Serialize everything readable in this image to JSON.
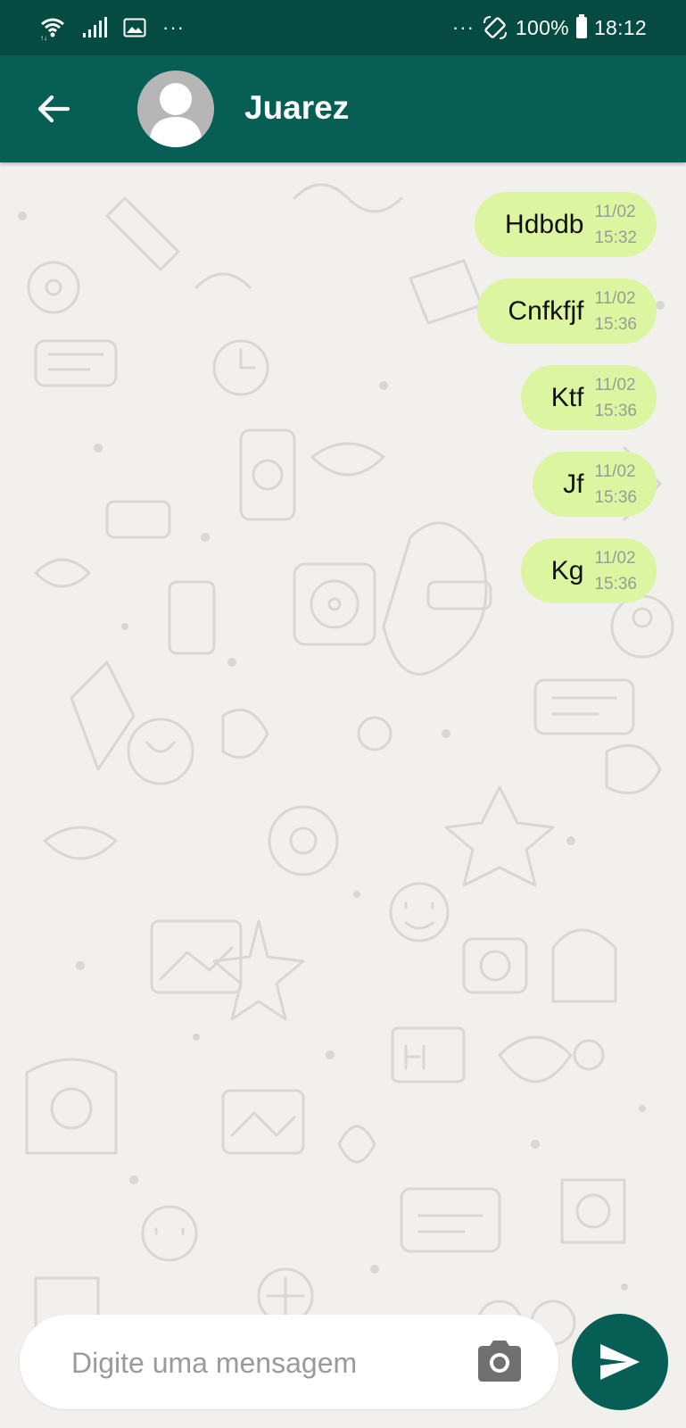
{
  "status_bar": {
    "left_dots": "···",
    "right_dots": "···",
    "battery": "100%",
    "time": "18:12"
  },
  "header": {
    "contact_name": "Juarez",
    "icons": [
      "back-arrow-icon",
      "avatar-person-icon"
    ]
  },
  "messages": [
    {
      "text": "Hdbdb",
      "date": "11/02",
      "time": "15:32"
    },
    {
      "text": "Cnfkfjf",
      "date": "11/02",
      "time": "15:36"
    },
    {
      "text": "Ktf",
      "date": "11/02",
      "time": "15:36"
    },
    {
      "text": "Jf",
      "date": "11/02",
      "time": "15:36"
    },
    {
      "text": "Kg",
      "date": "11/02",
      "time": "15:36"
    }
  ],
  "composer": {
    "placeholder": "Digite uma mensagem",
    "value": "",
    "icons": [
      "camera-icon",
      "send-icon"
    ]
  },
  "colors": {
    "status_bar": "#064b41",
    "app_bar": "#075e54",
    "bubble": "#dcf5a0",
    "send_button": "#075e54",
    "chat_background": "#f1f0ed"
  }
}
